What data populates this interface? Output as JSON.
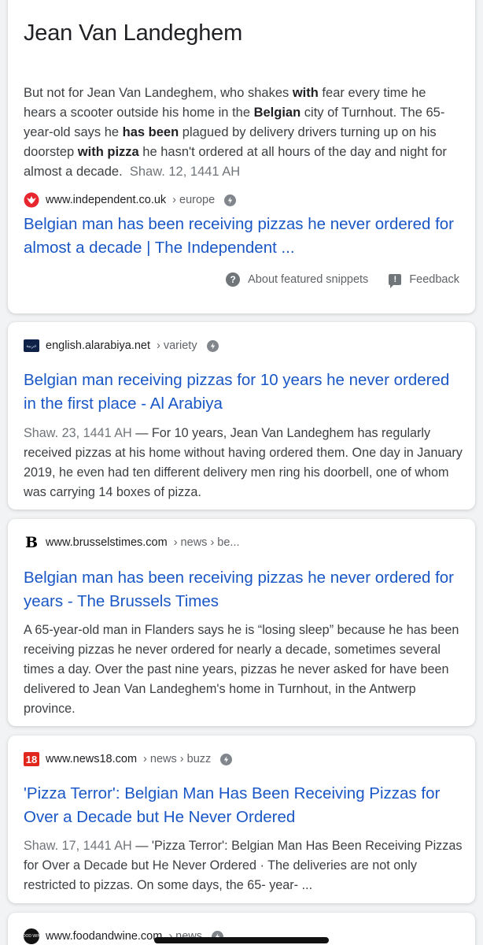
{
  "featured": {
    "title": "Jean Van Landeghem",
    "snippet": [
      {
        "t": "But not for Jean Van Landeghem, who shakes ",
        "b": false
      },
      {
        "t": "with",
        "b": true
      },
      {
        "t": " fear every time he hears a scooter outside his home in the ",
        "b": false
      },
      {
        "t": "Belgian",
        "b": true
      },
      {
        "t": " city of Turnhout. The 65-year-old says he ",
        "b": false
      },
      {
        "t": "has been",
        "b": true
      },
      {
        "t": " plagued by delivery drivers turning up on his doorstep ",
        "b": false
      },
      {
        "t": "with pizza",
        "b": true
      },
      {
        "t": " he hasn't ordered at all hours of the day and night for almost a decade.",
        "b": false
      }
    ],
    "date": "Shaw. 12, 1441 AH",
    "source": {
      "domain": "www.independent.co.uk",
      "crumb": "› europe",
      "icon": "independent-eagle-icon"
    },
    "link_title": "Belgian man has been receiving pizzas he never ordered for almost a decade | The Independent ...",
    "about_label": "About featured snippets",
    "feedback_label": "Feedback"
  },
  "results": [
    {
      "source": {
        "domain": "english.alarabiya.net",
        "crumb": "› variety",
        "icon": "alarabiya-icon"
      },
      "title": "Belgian man receiving pizzas for 10 years he never ordered in the first place - Al Arabiya",
      "date": "Shaw. 23, 1441 AH",
      "desc": " — For 10 years, Jean Van Landeghem has regularly received pizzas at his home without having ordered them. One day in January 2019, he even had ten different delivery men ring his doorbell, one of whom was carrying 14 boxes of pizza.",
      "amp": true
    },
    {
      "source": {
        "domain": "www.brusselstimes.com",
        "crumb": "› news › be...",
        "icon": "brussels-times-icon"
      },
      "title": "Belgian man has been receiving pizzas he never ordered for years - The Brussels Times",
      "date": "",
      "desc": "A 65-year-old man in Flanders says he is “losing sleep” because he has been receiving pizzas he never ordered for nearly a decade, sometimes several times a day. Over the past nine years, pizzas he never asked for have been delivered to Jean Van Landeghem's home in Turnhout, in the Antwerp province.",
      "amp": false
    },
    {
      "source": {
        "domain": "www.news18.com",
        "crumb": "› news › buzz",
        "icon": "news18-icon"
      },
      "title": "'Pizza Terror': Belgian Man Has Been Receiving Pizzas for Over a Decade but He Never Ordered",
      "date": "Shaw. 17, 1441 AH",
      "desc": " — 'Pizza Terror': Belgian Man Has Been Receiving Pizzas for Over a Decade but He Never Ordered · The deliveries are not only restricted to pizzas. On some days, the 65- year- ...",
      "amp": true
    },
    {
      "source": {
        "domain": "www.foodandwine.com",
        "crumb": "› news",
        "icon": "food-and-wine-icon"
      },
      "title": "",
      "date": "",
      "desc": "",
      "amp": true
    }
  ],
  "favicon_text": {
    "news18": "18",
    "brussels": "B",
    "foodwine": "FOOD WINE"
  },
  "colors": {
    "link": "#1a57c6",
    "background": "#f1f3f4",
    "independent": "#e8262e",
    "news18": "#e1261c"
  }
}
